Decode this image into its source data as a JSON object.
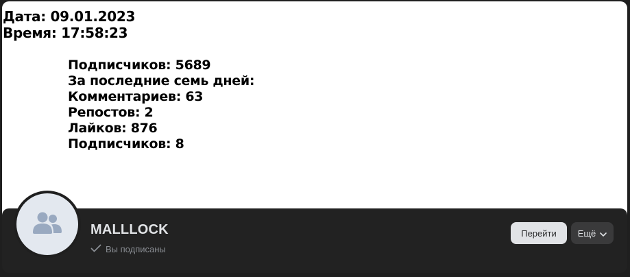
{
  "banner": {
    "date_line": "Дата: 09.01.2023",
    "time_line": "Время: 17:58:23",
    "stats": [
      "Подписчиков: 5689",
      "За последние семь дней:",
      "Комментариев: 63",
      "Репостов: 2",
      "Лайков: 876",
      "Подписчиков: 8"
    ]
  },
  "group": {
    "name": "MALLLOCK",
    "status": "Вы подписаны",
    "avatar_icon": "users-icon",
    "status_icon": "check-icon"
  },
  "actions": {
    "go_label": "Перейти",
    "more_label": "Ещё",
    "more_icon": "chevron-down-icon"
  },
  "colors": {
    "panel_bg": "#222222",
    "avatar_bg": "#e3e8ef",
    "avatar_icon": "#99a9c0",
    "primary_button_bg": "#e1e3e6",
    "secondary_button_bg": "#3a3a3b"
  }
}
